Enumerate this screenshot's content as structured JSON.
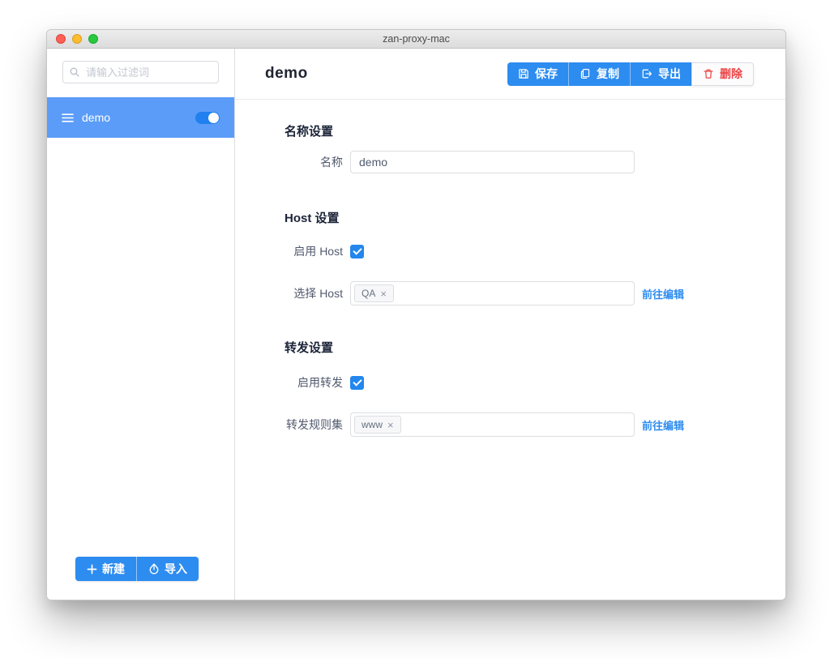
{
  "window": {
    "title": "zan-proxy-mac"
  },
  "sidebar": {
    "search": {
      "placeholder": "请输入过滤词"
    },
    "items": [
      {
        "label": "demo",
        "enabled": true
      }
    ],
    "actions": {
      "new_label": "新建",
      "import_label": "导入"
    }
  },
  "header": {
    "title": "demo",
    "toolbar": {
      "save": "保存",
      "copy": "复制",
      "export": "导出",
      "delete": "删除"
    }
  },
  "form": {
    "name_section": {
      "heading": "名称设置",
      "label": "名称",
      "value": "demo"
    },
    "host_section": {
      "heading": "Host 设置",
      "enable_label": "启用 Host",
      "enable_checked": true,
      "select_label": "选择 Host",
      "tag": "QA",
      "edit_link": "前往编辑"
    },
    "forward_section": {
      "heading": "转发设置",
      "enable_label": "启用转发",
      "enable_checked": true,
      "select_label": "转发规则集",
      "tag": "www",
      "edit_link": "前往编辑"
    }
  },
  "icons": {
    "search": "magnifier",
    "item_handle": "hamburger",
    "new": "plus",
    "import": "upload-circle",
    "save": "floppy-disk",
    "copy": "copy-pages",
    "export": "export-arrow",
    "delete": "trash",
    "tag_close_glyph": "×"
  },
  "colors": {
    "accent": "#2d8cf0",
    "sidebar_selected": "#5b9cf8",
    "toggle_on": "#2080f0",
    "checkbox": "#2387ee",
    "danger": "#ed4245",
    "traffic_red": "#ff5f57",
    "traffic_yellow": "#febc2e",
    "traffic_green": "#28c840"
  }
}
